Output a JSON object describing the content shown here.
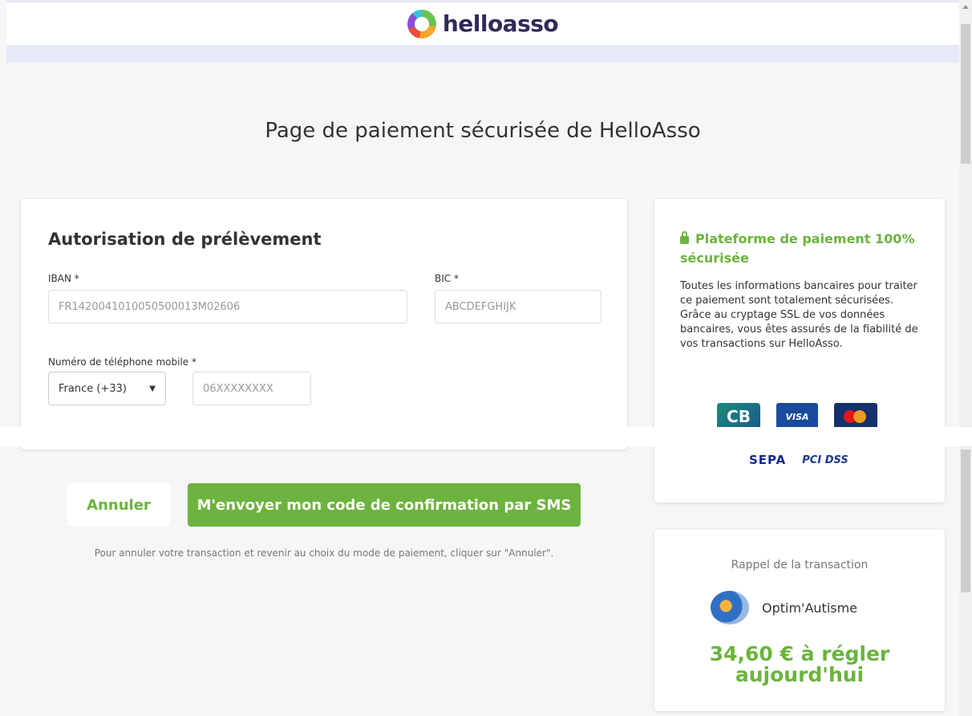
{
  "header": {
    "brand": "helloasso"
  },
  "page_title": "Page de paiement sécurisée de HelloAsso",
  "form": {
    "title": "Autorisation de prélèvement",
    "iban_label": "IBAN *",
    "iban_placeholder": "FR1420041010050500013M02606",
    "bic_label": "BIC *",
    "bic_placeholder": "ABCDEFGHIJK",
    "phone_label": "Numéro de téléphone mobile *",
    "country_selected": "France (+33)",
    "phone_placeholder": "06XXXXXXXX"
  },
  "actions": {
    "cancel_label": "Annuler",
    "sms_label": "M'envoyer mon code de confirmation par SMS",
    "cancel_hint": "Pour annuler votre transaction et revenir au choix du mode de paiement, cliquer sur \"Annuler\"."
  },
  "security": {
    "title": "Plateforme de paiement 100% sécurisée",
    "text": "Toutes les informations bancaires pour traiter ce paiement sont totalement sécurisées. Grâce au cryptage SSL de vos données bancaires, vous êtes assurés de la fiabilité de vos transactions sur HelloAsso.",
    "logos": {
      "cb": "CB",
      "visa": "VISA",
      "sepa": "SEPA",
      "pci": "PCI DSS"
    }
  },
  "recap": {
    "title": "Rappel de la transaction",
    "org_name": "Optim'Autisme",
    "amount": "34,60 € à régler aujourd'hui"
  },
  "colors": {
    "accent": "#6bb43c",
    "brand_dark": "#2f2b57"
  }
}
